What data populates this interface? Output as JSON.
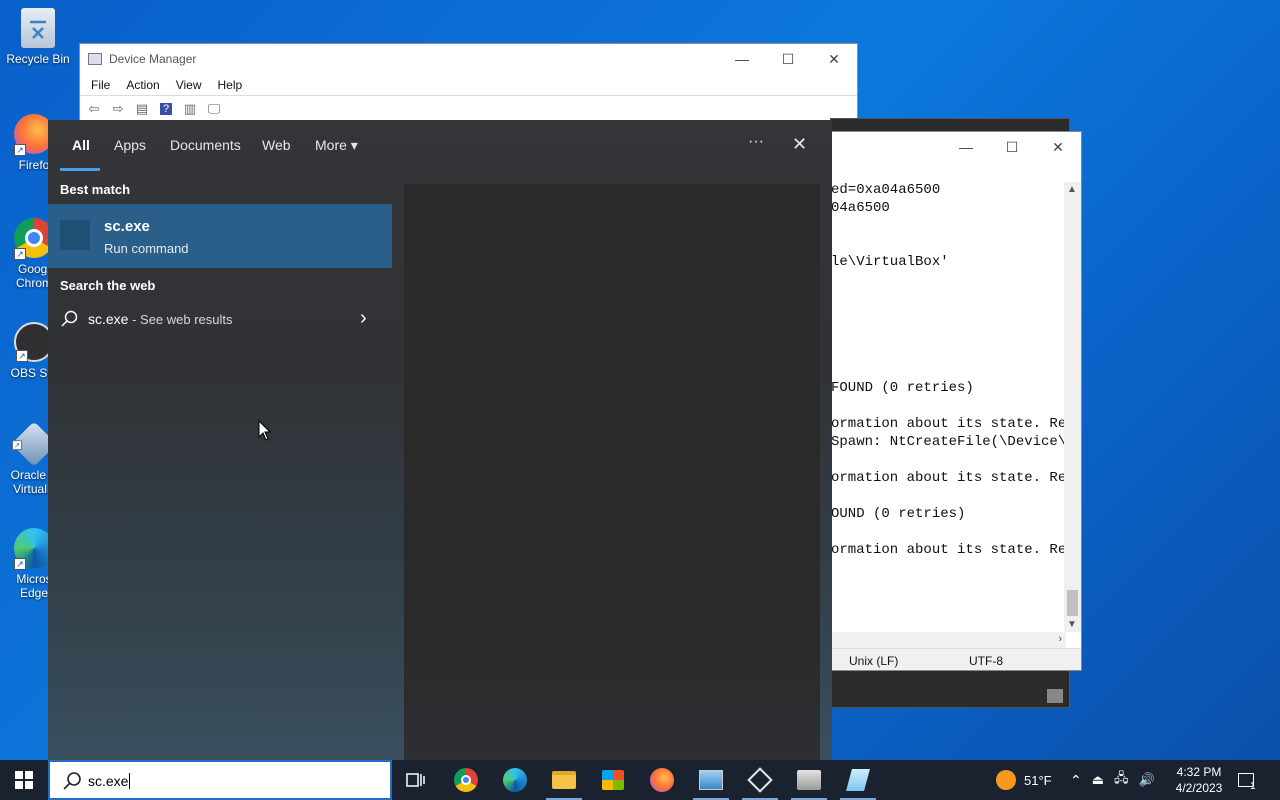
{
  "desktop": {
    "icons": [
      {
        "label": "Recycle Bin",
        "icon": "recycle-bin-icon"
      },
      {
        "label": "Firefo",
        "icon": "firefox-icon"
      },
      {
        "label": "Googl Chrom",
        "icon": "chrome-icon"
      },
      {
        "label": "OBS Stu",
        "icon": "obs-icon"
      },
      {
        "label": "Oracle V VirtualB",
        "icon": "virtualbox-icon"
      },
      {
        "label": "Micros Edge",
        "icon": "edge-icon"
      }
    ]
  },
  "device_manager": {
    "title": "Device Manager",
    "menu": [
      "File",
      "Action",
      "View",
      "Help"
    ],
    "minimize": "—",
    "maximize": "☐",
    "close": "✕"
  },
  "notepad": {
    "minimize": "—",
    "maximize": "☐",
    "close": "✕",
    "lines": [
      "ed=0xa04a6500",
      "04a6500",
      "",
      "",
      "le\\VirtualBox'",
      "",
      "",
      "",
      "",
      "",
      "",
      "FOUND (0 retries)",
      "",
      "ormation about its state. Reb",
      "Spawn: NtCreateFile(\\Device\\V",
      "",
      "ormation about its state. Reb",
      "",
      "OUND (0 retries)",
      "",
      "ormation about its state. Reb"
    ],
    "status": {
      "line_ending": "Unix (LF)",
      "encoding": "UTF-8"
    }
  },
  "search": {
    "tabs": {
      "all": "All",
      "apps": "Apps",
      "documents": "Documents",
      "web": "Web",
      "more": "More ▾"
    },
    "more_options": "···",
    "close": "✕",
    "best_match_heading": "Best match",
    "best_match": {
      "name": "sc.exe",
      "type": "Run command"
    },
    "web_heading": "Search the web",
    "web_result": {
      "query": "sc.exe",
      "suffix": " - See web results",
      "arrow": "›"
    },
    "query": "sc.exe"
  },
  "taskbar": {
    "apps": [
      {
        "name": "task-view",
        "icon": "task-view-icon"
      },
      {
        "name": "chrome",
        "icon": "chrome-icon"
      },
      {
        "name": "edge",
        "icon": "edge-icon"
      },
      {
        "name": "file-explorer",
        "icon": "folder-icon"
      },
      {
        "name": "microsoft-store",
        "icon": "store-icon"
      },
      {
        "name": "firefox",
        "icon": "firefox-icon"
      },
      {
        "name": "control-panel",
        "icon": "control-panel-icon"
      },
      {
        "name": "virtualbox",
        "icon": "virtualbox-icon"
      },
      {
        "name": "device-manager",
        "icon": "device-manager-icon"
      },
      {
        "name": "notepad",
        "icon": "notepad-icon"
      }
    ],
    "weather": "51°F",
    "time": "4:32 PM",
    "date": "4/2/2023",
    "notification_count": "1"
  },
  "colors": {
    "accent": "#0078d7",
    "selection": "#2a5f8a",
    "taskbar": "#1a2230"
  }
}
